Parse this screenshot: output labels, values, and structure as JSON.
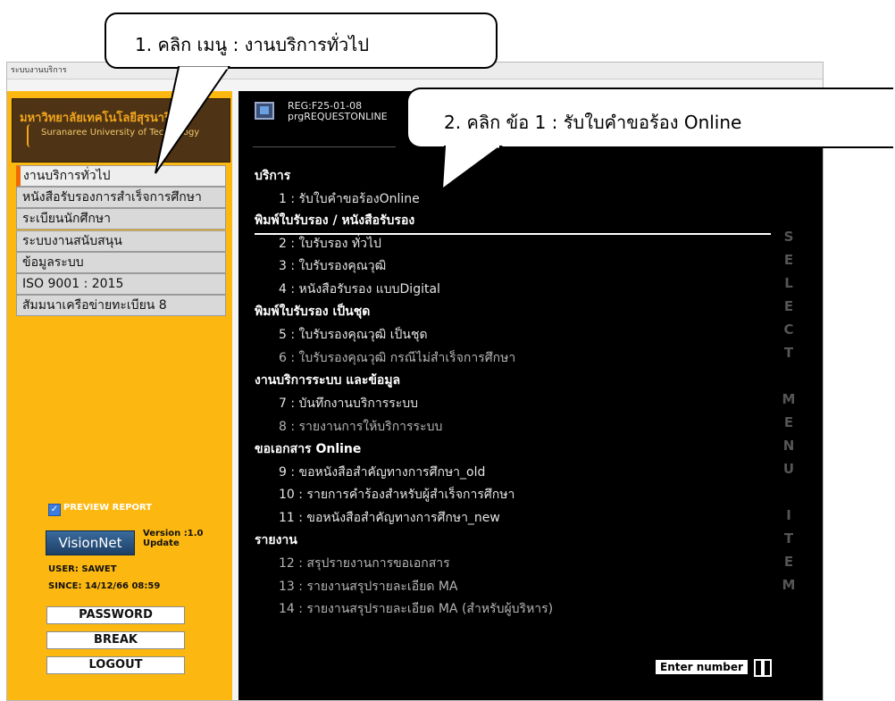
{
  "window": {
    "title": "ระบบงานบริการ"
  },
  "logo": {
    "title": "มหาวิทยาลัยเทคโนโลยีสุรนารี",
    "subtitle": "Suranaree University of Technology"
  },
  "sidebar": {
    "items": [
      {
        "label": "งานบริการทั่วไป",
        "active": true
      },
      {
        "label": "หนังสือรับรองการสำเร็จการศึกษา",
        "active": false
      },
      {
        "label": "ระเบียนนักศึกษา",
        "active": false
      },
      {
        "label": "ระบบงานสนับสนุน",
        "active": false
      },
      {
        "label": "ข้อมูลระบบ",
        "active": false
      },
      {
        "label": "ISO 9001 : 2015",
        "active": false
      },
      {
        "label": "สัมมนาเครือข่ายทะเบียน 8",
        "active": false
      }
    ],
    "preview_report": "PREVIEW REPORT",
    "preview_checked": true,
    "visionnet": "VisionNet",
    "version_line1": "Version :1.0",
    "version_line2": "Update",
    "user": "USER: SAWET",
    "since": "SINCE: 14/12/66 08:59",
    "buttons": {
      "password": "PASSWORD",
      "break": "BREAK",
      "logout": "LOGOUT"
    }
  },
  "program": {
    "code": "REG:F25-01-08",
    "name": "prgREQUESTONLINE",
    "icon": "monitor-icon"
  },
  "menu": {
    "sections": [
      {
        "title": "บริการ",
        "items": [
          {
            "label": "1 : รับใบคำขอร้องOnline",
            "dim": false
          }
        ]
      },
      {
        "title": "พิมพ์ใบรับรอง / หนังสือรับรอง",
        "items": [
          {
            "label": "2 : ใบรับรอง ทั่วไป",
            "dim": false
          },
          {
            "label": "3 : ใบรับรองคุณวุฒิ",
            "dim": false
          },
          {
            "label": "4 : หนังสือรับรอง แบบDigital",
            "dim": false
          }
        ]
      },
      {
        "title": "พิมพ์ใบรับรอง เป็นชุด",
        "items": [
          {
            "label": "5 : ใบรับรองคุณวุฒิ เป็นชุด",
            "dim": false
          },
          {
            "label": "6 : ใบรับรองคุณวุฒิ กรณีไม่สำเร็จการศึกษา",
            "dim": true
          }
        ]
      },
      {
        "title": "งานบริการระบบ และข้อมูล",
        "items": [
          {
            "label": "7 : บันทึกงานบริการระบบ",
            "dim": false
          },
          {
            "label": "8 : รายงานการให้บริการระบบ",
            "dim": true
          }
        ]
      },
      {
        "title": "ขอเอกสาร Online",
        "items": [
          {
            "label": "9 : ขอหนังสือสำคัญทางการศึกษา_old",
            "dim": false
          },
          {
            "label": "10 : รายการคำร้องสำหรับผู้สำเร็จการศึกษา",
            "dim": false
          },
          {
            "label": "11 : ขอหนังสือสำคัญทางการศึกษา_new",
            "dim": false
          }
        ]
      },
      {
        "title": "รายงาน",
        "items": [
          {
            "label": "12 : สรุปรายงานการขอเอกสาร",
            "dim": true
          },
          {
            "label": "13 : รายงานสรุปรายละเอียด MA",
            "dim": true
          },
          {
            "label": "14 : รายงานสรุปรายละเอียด MA (สำหรับผู้บริหาร)",
            "dim": true
          }
        ]
      }
    ],
    "side_text": [
      "S",
      "E",
      "L",
      "E",
      "C",
      "T",
      "",
      "M",
      "E",
      "N",
      "U",
      "",
      "I",
      "T",
      "E",
      "M"
    ],
    "enter_number": "Enter number"
  },
  "callouts": {
    "step1": "1. คลิก  เมนู  :  งานบริการทั่วไป",
    "step2": "2.  คลิก  ข้อ 1  :  รับใบคำขอร้อง Online"
  }
}
